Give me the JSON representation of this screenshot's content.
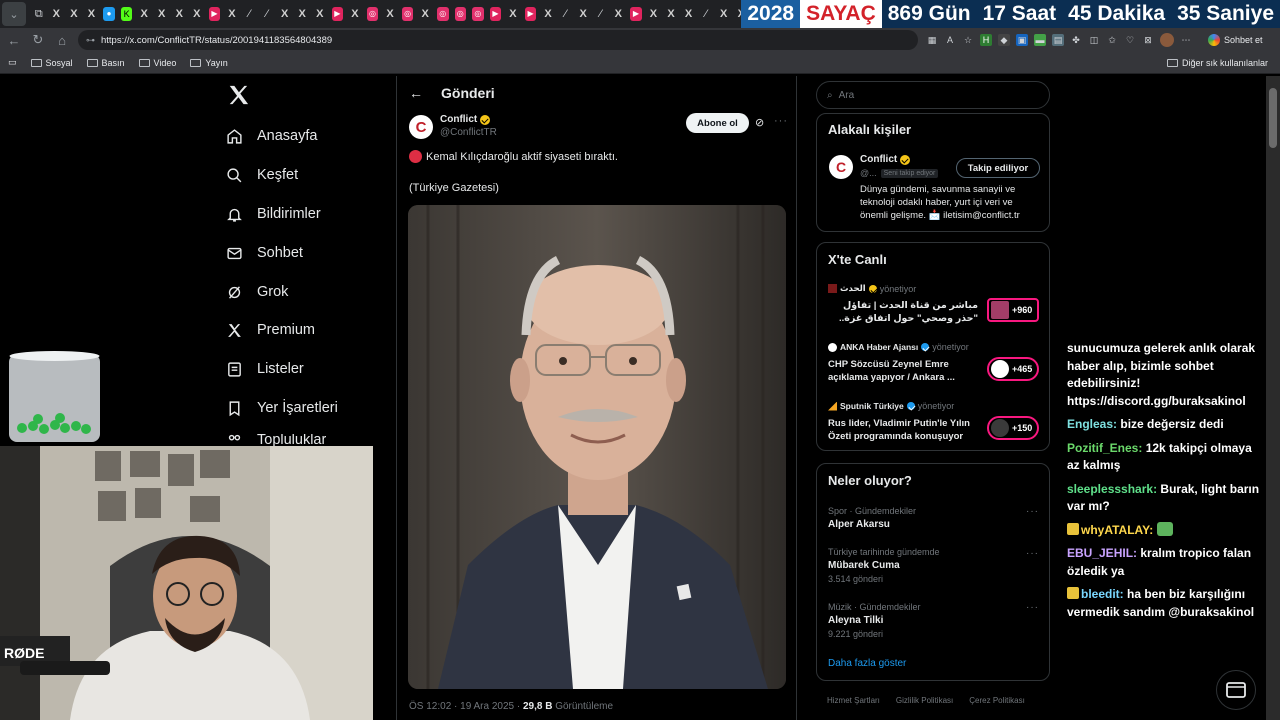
{
  "browser": {
    "url": "https://x.com/ConflictTR/status/2001941183564804389",
    "bookmarks": [
      "Sosyal",
      "Basın",
      "Video",
      "Yayın"
    ],
    "bookmarks_right": "Diğer sık kullanılanlar",
    "chat_button": "Sohbet et"
  },
  "counter": {
    "year": "2028",
    "label": "SAYAÇ",
    "days": "869 Gün",
    "hours": "17 Saat",
    "minutes": "45 Dakika",
    "seconds": "35 Saniye"
  },
  "nav": {
    "items": [
      "Anasayfa",
      "Keşfet",
      "Bildirimler",
      "Sohbet",
      "Grok",
      "Premium",
      "Listeler",
      "Yer İşaretleri",
      "Topluluklar"
    ]
  },
  "post": {
    "header_title": "Gönderi",
    "author_name": "Conflict",
    "author_handle": "@ConflictTR",
    "subscribe_label": "Abone ol",
    "text": "Kemal Kılıçdaroğlu aktif siyaseti bıraktı.",
    "source": "(Türkiye Gazetesi)",
    "time": "ÖS 12:02 · 19 Ara 2025 ·",
    "views": "29,8 B",
    "views_label": "Görüntüleme"
  },
  "sidebar": {
    "search_placeholder": "Ara",
    "related": {
      "title": "Alakalı kişiler",
      "name": "Conflict",
      "handle": "@...",
      "follows_you": "Seni takip ediyor",
      "follow_label": "Takip ediliyor",
      "bio": "Dünya gündemi, savunma sanayii ve teknoloji odaklı haber, yurt içi veri ve önemli gelişme. 📩 iletisim@conflict.tr"
    },
    "live": {
      "title": "X'te Canlı",
      "items": [
        {
          "host": "الحدث",
          "role": "yönetiyor",
          "text": "مباشر من قناة الحدث | تفاؤل \"حذر وصحي\" حول اتفاق غزة.. ومحادثات",
          "count": "+960"
        },
        {
          "host": "ANKA Haber Ajansı",
          "role": "yönetiyor",
          "text": "CHP Sözcüsü Zeynel Emre açıklama yapıyor / Ankara ...",
          "count": "+465"
        },
        {
          "host": "Sputnik Türkiye",
          "role": "yönetiyor",
          "text": "Rus lider, Vladimir Putin'le Yılın Özeti programında konuşuyor",
          "count": "+150"
        }
      ]
    },
    "trends": {
      "title": "Neler oluyor?",
      "items": [
        {
          "category": "Spor · Gündemdekiler",
          "name": "Alper Akarsu",
          "posts": ""
        },
        {
          "category": "Türkiye tarihinde gündemde",
          "name": "Mübarek Cuma",
          "posts": "3.514 gönderi"
        },
        {
          "category": "Müzik · Gündemdekiler",
          "name": "Aleyna Tilki",
          "posts": "9.221 gönderi"
        }
      ],
      "show_more": "Daha fazla göster"
    },
    "footer": [
      "Hizmet Şartları",
      "Gizlilik Politikası",
      "Çerez Politikası"
    ]
  },
  "chat": {
    "messages": [
      {
        "user": "",
        "text": "sunucumuza gelerek anlık olarak haber alıp, bizimle sohbet edebilirsiniz! https://discord.gg/buraksakinol"
      },
      {
        "user": "Engleas:",
        "text": "bize değersiz dedi"
      },
      {
        "user": "Pozitif_Enes:",
        "text": "12k takipçi olmaya az kalmış"
      },
      {
        "user": "sleeplessshark:",
        "text": "Burak, light barın var mı?"
      },
      {
        "user": "whyATALAY:",
        "text": ""
      },
      {
        "user": "EBU_JEHIL:",
        "text": "kralım tropico falan özledik ya"
      },
      {
        "user": "bleedit:",
        "text": "ha ben biz karşılığını vermedik sandım @buraksakinol"
      }
    ]
  },
  "colors": {
    "accent": "#1d9bf0",
    "verified_gold": "#f5c518",
    "live_pill": "#f91880",
    "background": "#000000"
  }
}
